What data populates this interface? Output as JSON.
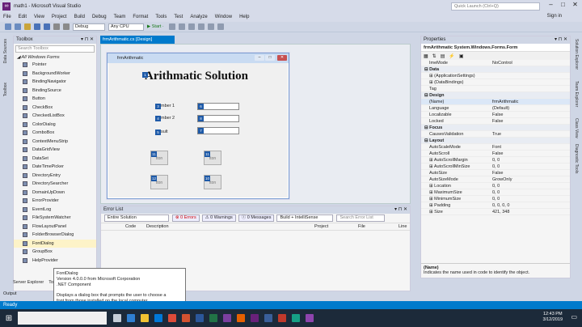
{
  "window": {
    "title": "math1 - Microsoft Visual Studio",
    "quick_launch_placeholder": "Quick Launch (Ctrl+Q)",
    "sign_in": "Sign in"
  },
  "menu": [
    "File",
    "Edit",
    "View",
    "Project",
    "Build",
    "Debug",
    "Team",
    "Format",
    "Tools",
    "Test",
    "Analyze",
    "Window",
    "Help"
  ],
  "toolbar": {
    "config": "Debug",
    "platform": "Any CPU",
    "start": "▶ Start ·"
  },
  "left_vtabs": [
    "Data Sources",
    "Toolbox"
  ],
  "right_vtabs": [
    "Solution Explorer",
    "Team Explorer",
    "Class View",
    "Diagnostic Tools"
  ],
  "toolbox": {
    "title": "Toolbox",
    "search_placeholder": "Search Toolbox",
    "group": "◢ All Windows Forms",
    "items": [
      "Pointer",
      "BackgroundWorker",
      "BindingNavigator",
      "BindingSource",
      "Button",
      "CheckBox",
      "CheckedListBox",
      "ColorDialog",
      "ComboBox",
      "ContextMenuStrip",
      "DataGridView",
      "DataSet",
      "DateTimePicker",
      "DirectoryEntry",
      "DirectorySearcher",
      "DomainUpDown",
      "ErrorProvider",
      "EventLog",
      "FileSystemWatcher",
      "FlowLayoutPanel",
      "FolderBrowserDialog",
      "FontDialog",
      "GroupBox",
      "HelpProvider"
    ],
    "selected": 21,
    "bottom_tabs": [
      "Server Explorer",
      "Toolbox"
    ],
    "output": "Output"
  },
  "designer": {
    "tab": "frmArithmatic.cs [Design]",
    "form_title": "frmArithmatic",
    "heading": "Arithmatic Solution",
    "labels": [
      {
        "tag": "3",
        "text": "mber 1"
      },
      {
        "tag": "4",
        "text": "mber 2"
      },
      {
        "tag": "5",
        "text": "sult"
      }
    ],
    "textboxes": [
      "6",
      "8",
      "7"
    ],
    "buttons": [
      {
        "tag": "11",
        "text": "tton"
      },
      {
        "tag": "11",
        "text": "tton"
      },
      {
        "tag": "12",
        "text": "tton"
      },
      {
        "tag": "10",
        "text": "tton"
      }
    ]
  },
  "errorlist": {
    "title": "Error List",
    "scope": "Entire Solution",
    "errors": "⊗ 0 Errors",
    "warnings": "⚠ 0 Warnings",
    "messages": "ⓘ 0 Messages",
    "filter": "Build + IntelliSense",
    "search": "Search Error List",
    "columns": [
      "Code",
      "Description",
      "Project",
      "File",
      "Line"
    ]
  },
  "properties": {
    "title": "Properties",
    "object": "frmArithmatic  System.Windows.Forms.Form",
    "rows": [
      {
        "n": "ImeMode",
        "v": "NoControl",
        "t": ""
      },
      {
        "n": "⊟ Data",
        "v": "",
        "t": "cat"
      },
      {
        "n": "⊞ (ApplicationSettings)",
        "v": "",
        "t": ""
      },
      {
        "n": "⊞ (DataBindings)",
        "v": "",
        "t": ""
      },
      {
        "n": "Tag",
        "v": "",
        "t": ""
      },
      {
        "n": "⊟ Design",
        "v": "",
        "t": "cat"
      },
      {
        "n": "(Name)",
        "v": "frmArithmatic",
        "t": "hi"
      },
      {
        "n": "Language",
        "v": "(Default)",
        "t": ""
      },
      {
        "n": "Localizable",
        "v": "False",
        "t": ""
      },
      {
        "n": "Locked",
        "v": "False",
        "t": ""
      },
      {
        "n": "⊟ Focus",
        "v": "",
        "t": "cat"
      },
      {
        "n": "CausesValidation",
        "v": "True",
        "t": ""
      },
      {
        "n": "⊟ Layout",
        "v": "",
        "t": "cat"
      },
      {
        "n": "AutoScaleMode",
        "v": "Font",
        "t": ""
      },
      {
        "n": "AutoScroll",
        "v": "False",
        "t": ""
      },
      {
        "n": "⊞ AutoScrollMargin",
        "v": "0, 0",
        "t": ""
      },
      {
        "n": "⊞ AutoScrollMinSize",
        "v": "0, 0",
        "t": ""
      },
      {
        "n": "AutoSize",
        "v": "False",
        "t": ""
      },
      {
        "n": "AutoSizeMode",
        "v": "GrowOnly",
        "t": ""
      },
      {
        "n": "⊞ Location",
        "v": "0, 0",
        "t": ""
      },
      {
        "n": "⊞ MaximumSize",
        "v": "0, 0",
        "t": ""
      },
      {
        "n": "⊞ MinimumSize",
        "v": "0, 0",
        "t": ""
      },
      {
        "n": "⊞ Padding",
        "v": "0, 0, 0, 0",
        "t": ""
      },
      {
        "n": "⊞ Size",
        "v": "421, 348",
        "t": ""
      }
    ],
    "desc_title": "(Name)",
    "desc_text": "Indicates the name used in code to identify the object."
  },
  "tooltip": {
    "lines": [
      "FontDialog",
      "Version 4.0.0.0 from Microsoft Corporation",
      ".NET Component",
      "",
      "Displays a dialog box that prompts the user to choose a",
      "font from those installed on the local computer."
    ]
  },
  "statusbar": "Ready",
  "taskbar": {
    "time": "12:43 PM",
    "date": "3/12/2019"
  }
}
